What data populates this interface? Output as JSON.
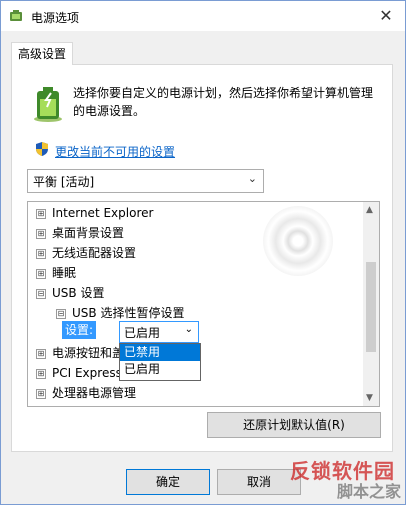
{
  "window": {
    "title": "电源选项",
    "close_glyph": "✕"
  },
  "tab": {
    "label": "高级设置"
  },
  "description": "选择你要自定义的电源计划，然后选择你希望计算机管理的电源设置。",
  "link": {
    "label": "更改当前不可用的设置"
  },
  "plan_select": {
    "value": "平衡 [活动]"
  },
  "tree": {
    "items": [
      {
        "label": "Internet Explorer",
        "expander": "⊞"
      },
      {
        "label": "桌面背景设置",
        "expander": "⊞"
      },
      {
        "label": "无线适配器设置",
        "expander": "⊞"
      },
      {
        "label": "睡眠",
        "expander": "⊞"
      },
      {
        "label": "USB 设置",
        "expander": "⊟"
      },
      {
        "label": "USB 选择性暂停设置",
        "expander": "⊟"
      },
      {
        "label": "电源按钮和盖",
        "expander": "⊞"
      },
      {
        "label": "PCI Express",
        "expander": "⊞"
      },
      {
        "label": "处理器电源管理",
        "expander": "⊞"
      }
    ],
    "setting_label": "设置:",
    "dropdown_value": "已启用",
    "dropdown_options": [
      "已禁用",
      "已启用"
    ]
  },
  "buttons": {
    "restore": "还原计划默认值(R)",
    "ok": "确定",
    "cancel": "取消"
  },
  "watermark": {
    "line1": "反锁软件园",
    "line2": "脚本之家"
  },
  "colors": {
    "accent": "#0078d7",
    "link": "#0a64c8",
    "selection": "#3399ff"
  }
}
